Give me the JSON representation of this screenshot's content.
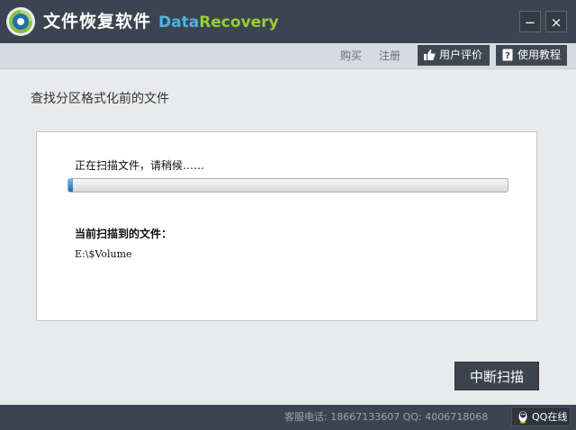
{
  "titlebar": {
    "title": "文件恢复软件",
    "brand_part1": "Data",
    "brand_part2": "Recovery",
    "minimize_label": "−",
    "close_label": "×"
  },
  "toolbar": {
    "buy_label": "购买",
    "register_label": "注册",
    "reviews_label": "用户评价",
    "tutorial_label": "使用教程"
  },
  "main": {
    "section_title": "查找分区格式化前的文件",
    "scan_status": "正在扫描文件，请稍候……",
    "progress_fraction": 0.01,
    "current_label": "当前扫描到的文件：",
    "current_path": "E:\\$Volume",
    "stop_button": "中断扫描"
  },
  "footer": {
    "contact": "客服电话: 18667133607 QQ: 4006718068",
    "qq_online": "QQ在线"
  },
  "colors": {
    "titlebar_bg": "#3b4450",
    "brand_blue": "#4fb3e8",
    "brand_green": "#9acd32",
    "progress_fill": "#1c6fb1"
  },
  "icons": [
    "app-logo-icon",
    "thumbs-up-icon",
    "question-book-icon",
    "qq-penguin-icon"
  ]
}
